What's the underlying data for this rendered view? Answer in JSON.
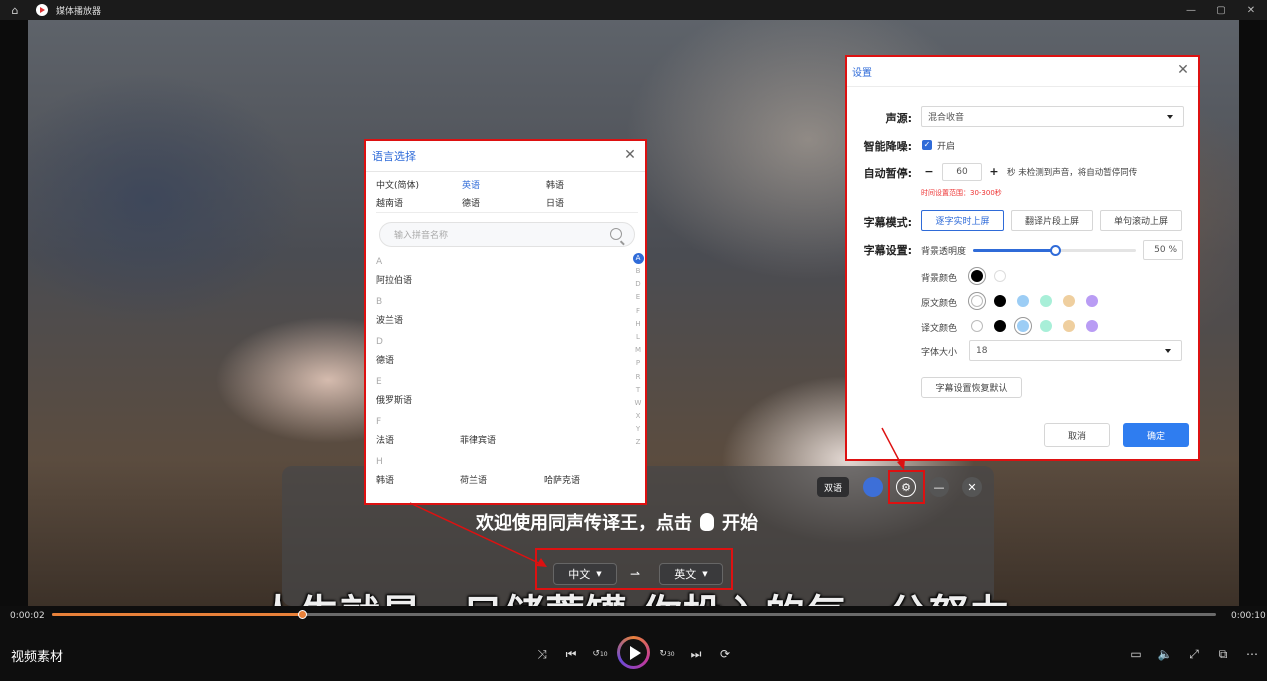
{
  "window": {
    "title": "媒体播放器",
    "controls": [
      "—",
      "▢",
      "✕"
    ]
  },
  "subtitle_tool": {
    "bilingual_label": "双语",
    "welcome_text": "欢迎使用同声传译王，点击",
    "welcome_end": "开始",
    "source_lang": "中文",
    "target_lang": "英文"
  },
  "video_subtitle": "人生就是一只储蓄罐 你投入的每一分努力",
  "player": {
    "current_time": "0:00:02",
    "total_time": "0:00:10",
    "progress": 0.215,
    "file_name": "视频素材",
    "skip_back_label": "10",
    "skip_forward_label": "30"
  },
  "language_dialog": {
    "title": "语言选择",
    "common": [
      [
        "中文(简体)",
        "英语",
        "韩语"
      ],
      [
        "越南语",
        "德语",
        "日语"
      ]
    ],
    "selected_common": "英语",
    "search_placeholder": "输入拼音名称",
    "groups": [
      {
        "letter": "A",
        "items": [
          "阿拉伯语"
        ]
      },
      {
        "letter": "B",
        "items": [
          "波兰语"
        ]
      },
      {
        "letter": "D",
        "items": [
          "德语"
        ]
      },
      {
        "letter": "E",
        "items": [
          "俄罗斯语"
        ]
      },
      {
        "letter": "F",
        "items": [
          "法语",
          "菲律宾语"
        ]
      },
      {
        "letter": "H",
        "items": [
          "韩语",
          "荷兰语",
          "哈萨克语"
        ]
      }
    ],
    "az": [
      "A",
      "B",
      "D",
      "E",
      "F",
      "H",
      "L",
      "M",
      "P",
      "R",
      "T",
      "W",
      "X",
      "Y",
      "Z"
    ]
  },
  "settings_dialog": {
    "title": "设置",
    "source_label": "声源:",
    "source_value": "混合收音",
    "denoise_label": "智能降噪:",
    "denoise_option": "开启",
    "denoise_on": true,
    "autopause_label": "自动暂停:",
    "autopause_value": "60",
    "autopause_desc": "秒 未检测到声音，将自动暂停同传",
    "autopause_range": "时间设置范围：30-300秒",
    "mode_label": "字幕模式:",
    "modes": [
      "逐字实时上屏",
      "翻译片段上屏",
      "单句滚动上屏"
    ],
    "active_mode": "逐字实时上屏",
    "subtitle_label": "字幕设置:",
    "opacity_label": "背景透明度",
    "opacity_value": "50",
    "opacity_unit": "%",
    "opacity_fraction": 0.5,
    "bg_color_label": "背景颜色",
    "orig_color_label": "原文颜色",
    "trans_color_label": "译文颜色",
    "font_size_label": "字体大小",
    "font_size_value": "18",
    "reset_label": "字幕设置恢复默认",
    "cancel_label": "取消",
    "ok_label": "确定",
    "bg_colors": [
      "#000000",
      "#ffffff"
    ],
    "text_colors": [
      "#ffffff",
      "#000000",
      "#9ccdf5",
      "#a8efd8",
      "#efcf9f",
      "#b99cf4"
    ]
  },
  "accent": "#2f6bd8",
  "annotation_color": "#dd1111"
}
